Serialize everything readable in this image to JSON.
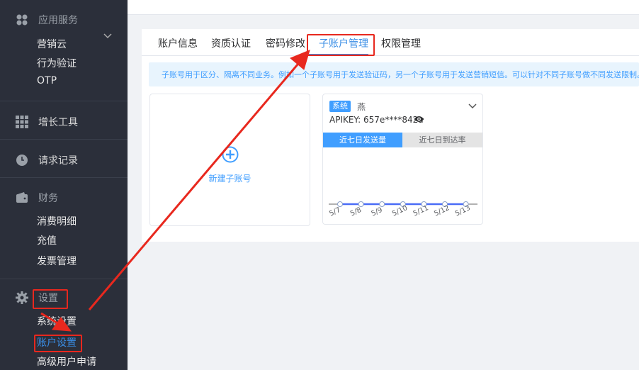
{
  "sidebar": {
    "sections": [
      {
        "title": "应用服务",
        "icon": "app-service-icon",
        "items": [
          "营销云",
          "行为验证",
          "OTP"
        ]
      },
      {
        "title": "增长工具",
        "icon": "grid-icon",
        "items": []
      },
      {
        "title": "请求记录",
        "icon": "clock-icon",
        "items": []
      },
      {
        "title": "财务",
        "icon": "wallet-icon",
        "items": [
          "消费明细",
          "充值",
          "发票管理"
        ]
      },
      {
        "title": "设置",
        "icon": "gear-icon",
        "items": [
          "系统设置",
          "账户设置",
          "高级用户申请"
        ]
      }
    ]
  },
  "tabs": [
    "账户信息",
    "资质认证",
    "密码修改",
    "子账户管理",
    "权限管理"
  ],
  "active_tab": "子账户管理",
  "notice": "子账号用于区分、隔离不同业务。例如一个子账号用于发送验证码，另一个子账号用于发送营销短信。可以针对不同子账号做不同发送限制。",
  "new_subaccount_label": "新建子账号",
  "account_card": {
    "badge": "系统",
    "name": "燕",
    "apikey": "APIKEY: 657e****842a",
    "tab_active": "近七日发送量",
    "tab_inactive": "近七日到达率"
  },
  "chart_data": {
    "type": "line",
    "x": [
      "5/7",
      "5/8",
      "5/9",
      "5/10",
      "5/11",
      "5/12",
      "5/13"
    ],
    "series": [
      {
        "values": [
          0,
          0,
          0,
          0,
          0,
          0,
          0
        ]
      }
    ],
    "line_color": "#4a6cf7"
  },
  "colors": {
    "accent": "#409eff",
    "annotation": "#e8281e",
    "sidebar_bg": "#2b2f3a"
  }
}
